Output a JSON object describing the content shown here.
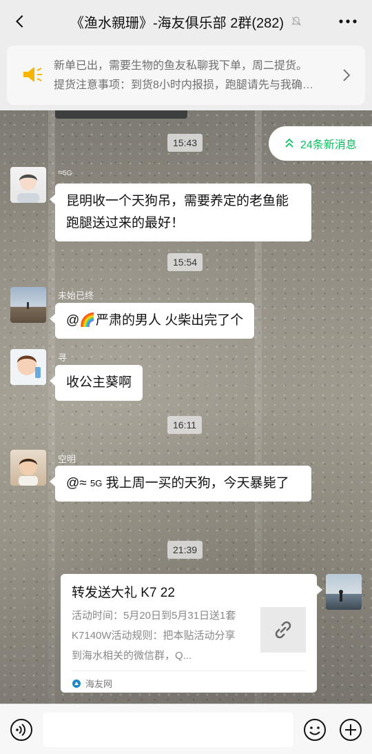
{
  "header": {
    "title": "《渔水親珊》-海友俱乐部 2群(282)",
    "icons": [
      "back-arrow-icon",
      "mute-bell-icon",
      "more-icon"
    ]
  },
  "notice": {
    "line1": "新单已出，需要生物的鱼友私聊我下单，周二提货。",
    "line2": "提货注意事项：到货8小时内报损，跑腿请先与我确…",
    "icons": [
      "speaker-icon",
      "chevron-right-icon"
    ]
  },
  "new_messages": {
    "label": "24条新消息"
  },
  "times": {
    "t1": "15:43",
    "t2": "15:54",
    "t3": "16:11",
    "t4": "21:39"
  },
  "messages": [
    {
      "sender": "",
      "signal": "5G",
      "text": "昆明收一个天狗吊，需要养定的老鱼能跑腿送过来的最好！"
    },
    {
      "sender": "未始已终",
      "text": "@🌈严肃的男人  火柴出完了个"
    },
    {
      "sender": "寻",
      "text": "收公主葵啊"
    },
    {
      "sender": "空明",
      "text": "@ 5G 我上周一买的天狗，今天暴毙了",
      "mention_label": "@",
      "signal": "5G",
      "rest": "我上周一买的天狗，今天暴毙了"
    }
  ],
  "card": {
    "title": "转发送大礼 K7 22",
    "desc": "活动时间：5月20日到5月31日送1套K7140W活动规则：把本贴活动分享到海水相关的微信群，Q...",
    "source": "海友网"
  },
  "colors": {
    "accent_green": "#07c160",
    "background": "#ededed",
    "speaker_yellow": "#f7b500"
  }
}
